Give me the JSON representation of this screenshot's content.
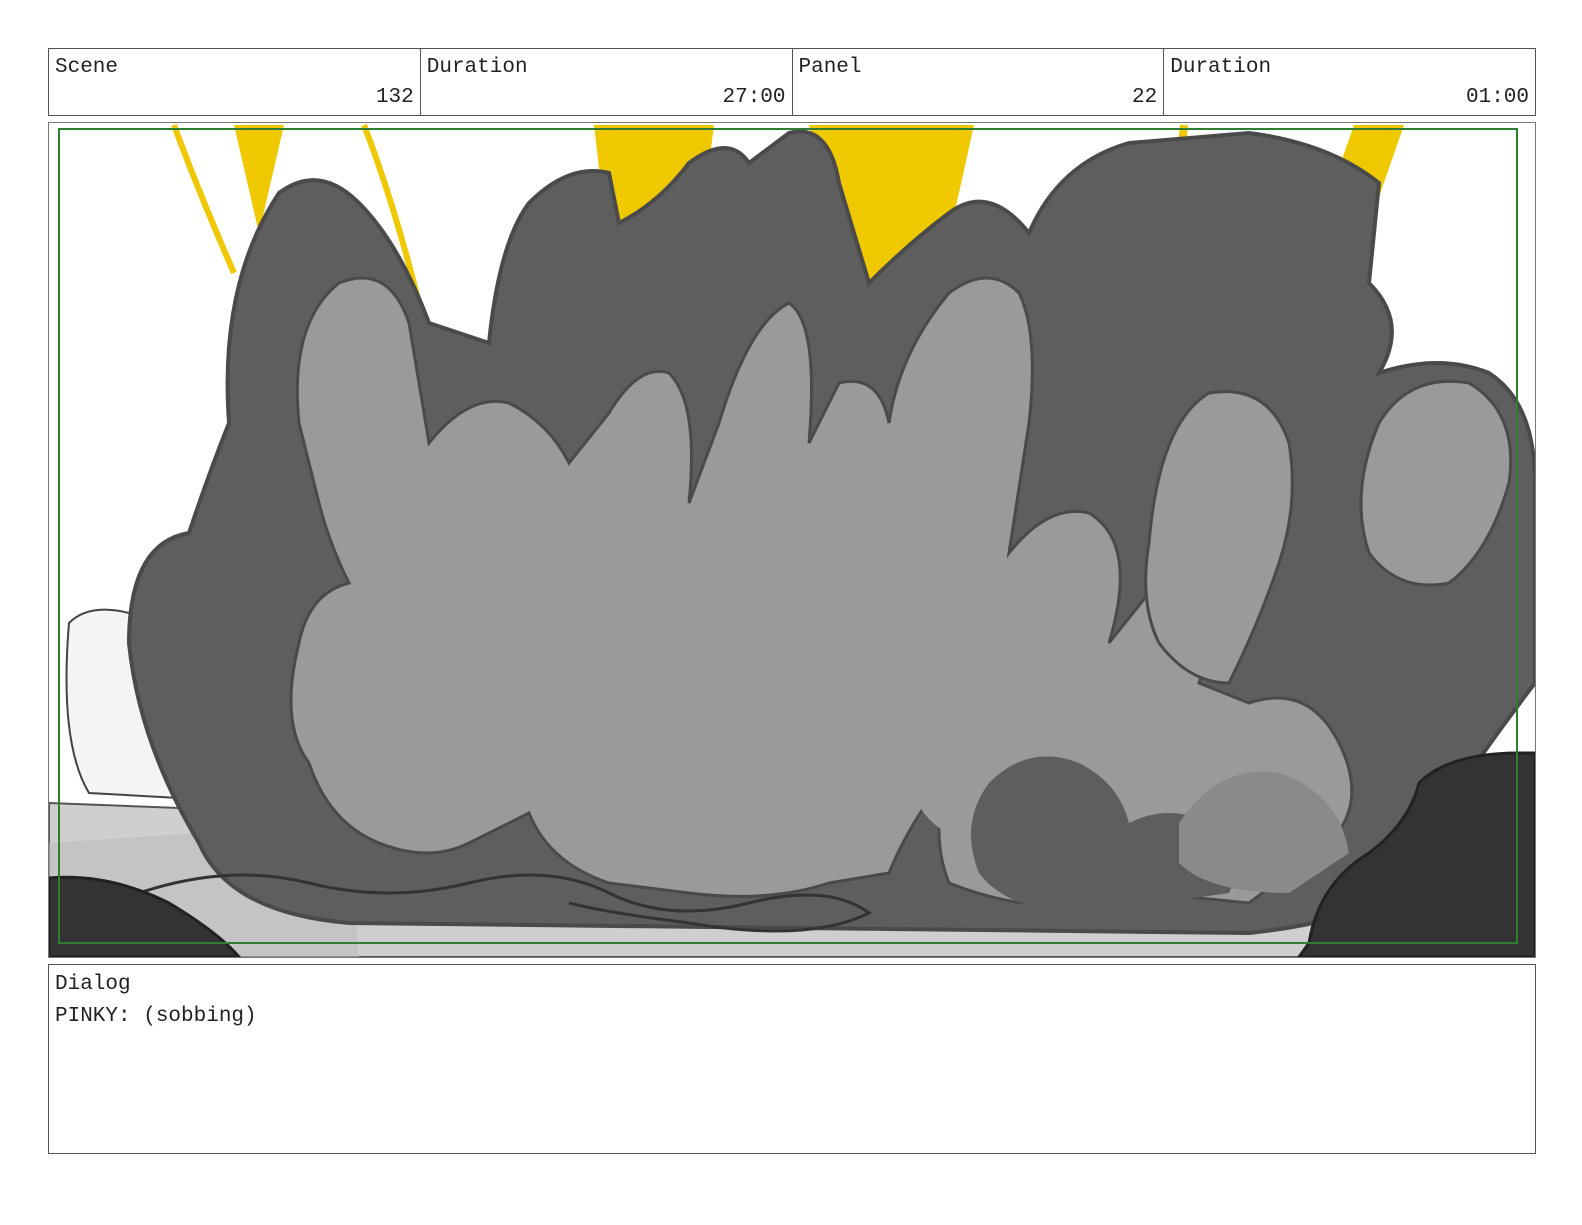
{
  "header": {
    "scene_label": "Scene",
    "scene_value": "132",
    "scene_duration_label": "Duration",
    "scene_duration_value": "27:00",
    "panel_label": "Panel",
    "panel_value": "22",
    "panel_duration_label": "Duration",
    "panel_duration_value": "01:00"
  },
  "artwork": {
    "description_icon": "explosion-smoke-cloud-illustration",
    "colors": {
      "smoke_dark": "#5e5e5e",
      "smoke_mid": "#9a9a9a",
      "smoke_outline": "#4a4a4a",
      "flame_yellow": "#f0c800",
      "ground": "#c8c8c8",
      "rock": "#333333",
      "safe_frame": "#2e7d32"
    }
  },
  "dialog": {
    "label": "Dialog",
    "text": "PINKY: (sobbing)"
  }
}
